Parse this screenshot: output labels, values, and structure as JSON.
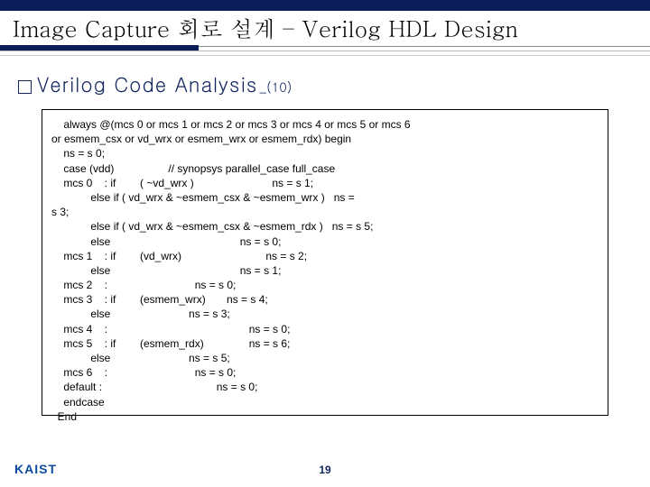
{
  "title": "Image Capture 회로 설계 – Verilog HDL Design",
  "subhead_main": "Verilog Code Analysis",
  "subhead_sub": "_(10)",
  "code": "    always @(mcs 0 or mcs 1 or mcs 2 or mcs 3 or mcs 4 or mcs 5 or mcs 6\nor esmem_csx or vd_wrx or esmem_wrx or esmem_rdx) begin\n    ns = s 0;\n    case (vdd)                  // synopsys parallel_case full_case\n    mcs 0    : if        ( ~vd_wrx )                          ns = s 1;\n             else if ( vd_wrx & ~esmem_csx & ~esmem_wrx )   ns =\ns 3;\n             else if ( vd_wrx & ~esmem_csx & ~esmem_rdx )   ns = s 5;\n             else                                           ns = s 0;\n    mcs 1    : if        (vd_wrx)                            ns = s 2;\n             else                                           ns = s 1;\n    mcs 2    :                             ns = s 0;\n    mcs 3    : if        (esmem_wrx)       ns = s 4;\n             else                          ns = s 3;\n    mcs 4    :                                               ns = s 0;\n    mcs 5    : if        (esmem_rdx)               ns = s 6;\n             else                          ns = s 5;\n    mcs 6    :                             ns = s 0;\n    default :                                      ns = s 0;\n    endcase\n  End",
  "page_number": "19",
  "logo_text": "KAIST"
}
